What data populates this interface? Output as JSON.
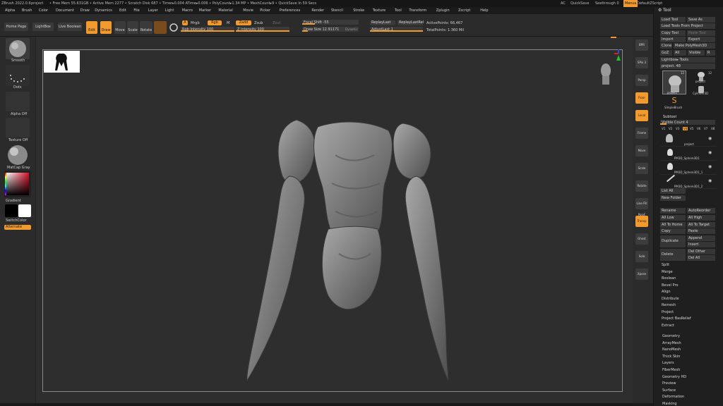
{
  "titlebar": {
    "app": "ZBrush 2022.0.6",
    "project": "project",
    "stats": "• Free Mem 55.631GB • Active Mem 2277 • Scratch Disk 687 • Timer▸0.004 ATime▸0.006 • PolyCount▸1.34 MP • MeshCount▸9 • QuickSave In 59 Secs",
    "ac": "AC",
    "quicksave": "QuickSave",
    "seethrough": "Seethrough 0",
    "menus": "Menus",
    "defaultzscript": "DefaultZScript"
  },
  "menubar": [
    "Alpha",
    "Brush",
    "Color",
    "Document",
    "Draw",
    "Dynamics",
    "Edit",
    "File",
    "Layer",
    "Light",
    "Macro",
    "Marker",
    "Material",
    "Movie",
    "Picker",
    "Preferences",
    "Render",
    "Stencil",
    "Stroke",
    "Texture",
    "Tool",
    "Transform",
    "Zplugin",
    "Zscript",
    "Help"
  ],
  "topshelf": {
    "home": "Home Page",
    "lightbox": "LightBox",
    "liveboolean": "Live Boolean",
    "edit": "Edit",
    "draw": "Draw",
    "move": "Move",
    "scale": "Scale",
    "rotate": "Rotate",
    "a": "A",
    "mrgb": "Mrgb",
    "rgb": "Rgb",
    "m": "M",
    "zadd": "Zadd",
    "zsub": "Zsub",
    "zcut": "Zcut",
    "rgb_intensity": "Rgb Intensity 100",
    "z_intensity": "Z Intensity 100",
    "focal_shift": "Focal Shift -55",
    "draw_size": "Draw Size 12.91171",
    "dynamic": "Dynamic",
    "replaylast": "ReplayLast",
    "replaylastrel": "ReplayLastRel",
    "adjustlast": "AdjustLast 1",
    "activepoints": "ActivePoints: 66,467",
    "totalpoints": "TotalPoints: 1.360 Mil"
  },
  "leftshelf": {
    "smooth": "Smooth",
    "dots": "Dots",
    "alpha": "Alpha Off",
    "texture": "Texture Off",
    "matcap": "MatCap Gray",
    "gradient": "Gradient",
    "switchcolor": "SwitchColor",
    "alternate": "Alternate",
    "color_fg": "#000000",
    "color_bg": "#ffffff"
  },
  "rightshelf": [
    "BPR",
    "SPix 3",
    "Persp",
    "Floor",
    "Local",
    "Frame",
    "Move",
    "Scale",
    "Rotate",
    "Line Fill PolyF",
    "Transp",
    "Ghost",
    "Solo",
    "Xpose"
  ],
  "panel": {
    "title": "Tool",
    "load_tool": "Load Tool",
    "save_as": "Save As",
    "load_from_project": "Load Tools From Project",
    "copy_tool": "Copy Tool",
    "paste_tool": "Paste Tool",
    "import": "Import",
    "export": "Export",
    "clone": "Clone",
    "make_polymesh": "Make PolyMesh3D",
    "goz": "GoZ",
    "all": "All",
    "visible": "Visible",
    "r": "R",
    "lightbox_tools": "Lightbox▸ Tools",
    "project": "project. 48",
    "tool1": "project",
    "tool2": "project",
    "tool3": "Cylinder3D",
    "tool4": "SimpleBrush",
    "count1": "12",
    "count2": "12",
    "subtool": "Subtool",
    "visible_count": "Visible Count 4",
    "v_tabs": [
      "V1",
      "V2",
      "V3",
      "V4",
      "V5",
      "V6",
      "V7",
      "V8"
    ],
    "subtools": [
      "project",
      "PM3D_Sphere3D1",
      "PM3D_Sphere3D1_1",
      "PM3D_Sphere3D1_2"
    ],
    "list_all": "List All",
    "new_folder": "New Folder",
    "rename": "Rename",
    "autoreorder": "AutoReorder",
    "all_low": "All Low",
    "all_high": "All High",
    "all_to_home": "All To Home",
    "all_to_target": "All To Target",
    "copy": "Copy",
    "paste": "Paste",
    "duplicate": "Duplicate",
    "append": "Append",
    "insert": "Insert",
    "delete": "Delete",
    "del_other": "Del Other",
    "del_all": "Del All",
    "menu_items": [
      "Split",
      "Merge",
      "Boolean",
      "Bevel Pro",
      "Align",
      "Distribute",
      "Remesh",
      "Project",
      "Project BasRelief",
      "Extract"
    ],
    "sections": [
      "Geometry",
      "ArrayMesh",
      "NanoMesh",
      "Thick Skin",
      "Layers",
      "FiberMesh",
      "Geometry HD",
      "Preview",
      "Surface",
      "Deformation",
      "Masking"
    ]
  }
}
